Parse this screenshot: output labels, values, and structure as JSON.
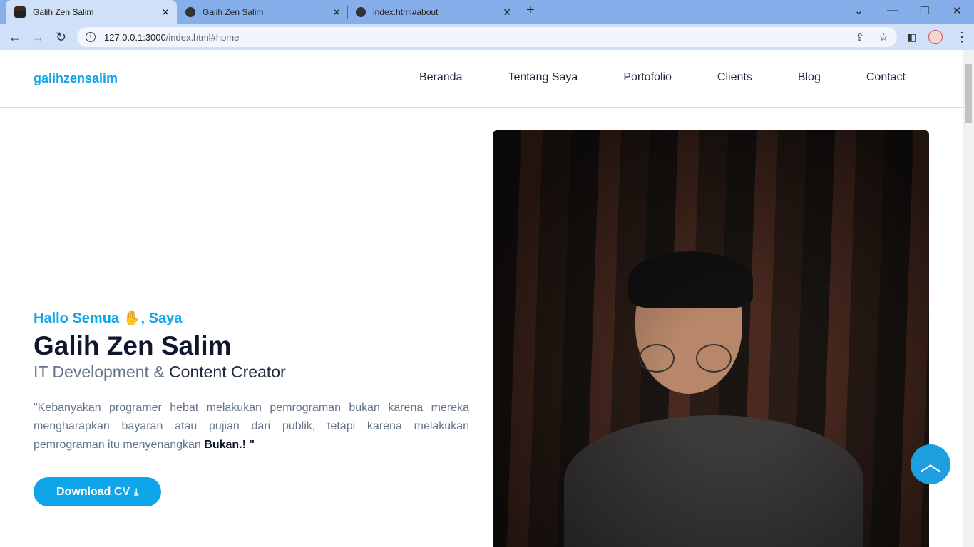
{
  "browser": {
    "tabs": [
      {
        "title": "Galih Zen Salim",
        "active": true,
        "icon": "profile-favicon"
      },
      {
        "title": "Galih Zen Salim",
        "icon": "globe-icon"
      },
      {
        "title": "index.html#about",
        "icon": "globe-icon"
      }
    ],
    "url_host": "127.0.0.1:3000",
    "url_path": "/index.html#home"
  },
  "site": {
    "logo": "galihzensalim",
    "nav": [
      "Beranda",
      "Tentang Saya",
      "Portofolio",
      "Clients",
      "Blog",
      "Contact"
    ],
    "hero": {
      "greeting": "Hallo Semua ✋, Saya",
      "name": "Galih Zen Salim",
      "subtitle_a": "IT Development &",
      "subtitle_b": "Content Creator",
      "quote": "\"Kebanyakan programer hebat melakukan pemrograman bukan karena mereka mengharapkan bayaran atau pujian dari publik, tetapi karena melakukan pemrograman itu menyenangkan",
      "quote_bold": "Bukan.! \"",
      "button": "Download CV"
    },
    "accent": "#0ea5e9"
  }
}
